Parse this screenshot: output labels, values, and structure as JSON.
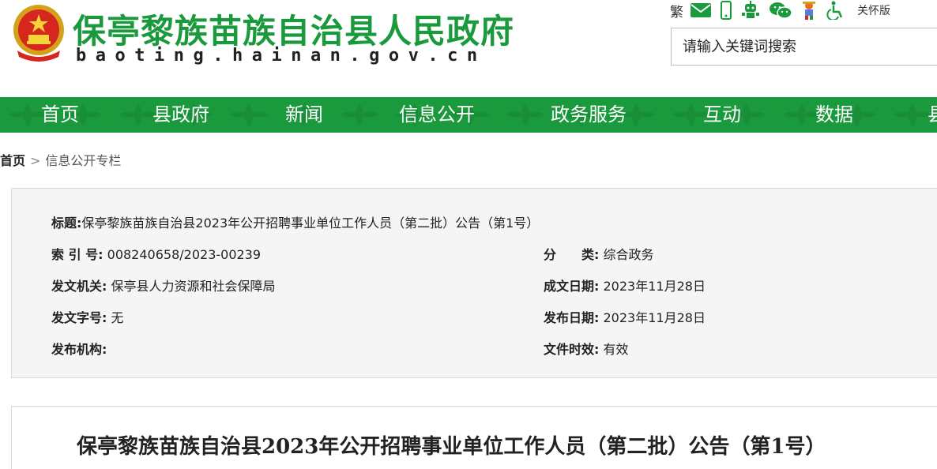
{
  "header": {
    "site_title": "保亭黎族苗族自治县人民政府",
    "site_domain": "baoting.hainan.gov.cn",
    "tools": {
      "traditional_label": "繁",
      "care_mode_label": "关怀版",
      "icons": [
        "mail-icon",
        "mobile-icon",
        "robot-icon",
        "wechat-icon",
        "mascot-icon",
        "accessibility-icon"
      ]
    },
    "search": {
      "placeholder": "请输入关键词搜索"
    }
  },
  "colors": {
    "brand_green": "#1a9a3c",
    "panel_bg": "#f5f5f5"
  },
  "nav": {
    "items": [
      "首页",
      "县政府",
      "新闻",
      "信息公开",
      "政务服务",
      "互动",
      "数据",
      "县"
    ]
  },
  "breadcrumb": {
    "home": "首页",
    "separator": ">",
    "current": "信息公开专栏"
  },
  "info": {
    "title_label": "标题:",
    "title_value": "保亭黎族苗族自治县2023年公开招聘事业单位工作人员（第二批）公告（第1号）",
    "index_label": "索 引 号:",
    "index_value": "008240658/2023-00239",
    "category_label": "分　　类:",
    "category_value": "综合政务",
    "issuer_label": "发文机关:",
    "issuer_value": "保亭县人力资源和社会保障局",
    "written_date_label": "成文日期:",
    "written_date_value": "2023年11月28日",
    "doc_number_label": "发文字号:",
    "doc_number_value": "无",
    "publish_date_label": "发布日期:",
    "publish_date_value": "2023年11月28日",
    "publisher_label": "发布机构:",
    "publisher_value": "",
    "validity_label": "文件时效:",
    "validity_value": "有效"
  },
  "article": {
    "title": "保亭黎族苗族自治县2023年公开招聘事业单位工作人员（第二批）公告（第1号）"
  }
}
